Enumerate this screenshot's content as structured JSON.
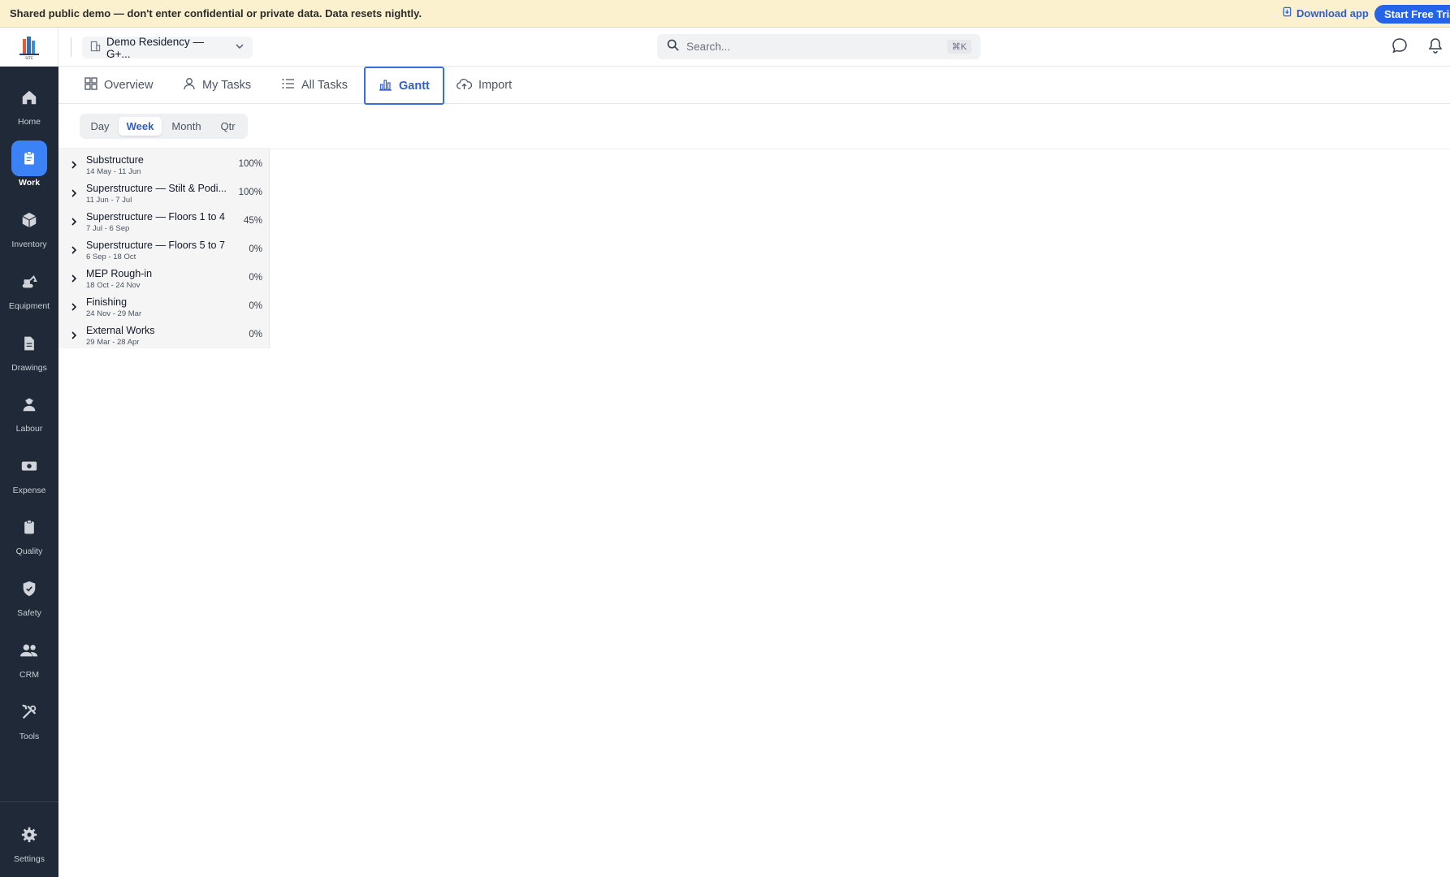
{
  "banner": {
    "text": "Shared public demo — don't enter confidential or private data. Data resets nightly.",
    "download_label": "Download app",
    "trial_label": "Start Free Trial"
  },
  "sidebar": {
    "items": [
      {
        "label": "Home",
        "icon": "home-icon"
      },
      {
        "label": "Work",
        "icon": "clipboard-icon",
        "active": true
      },
      {
        "label": "Inventory",
        "icon": "box-icon"
      },
      {
        "label": "Equipment",
        "icon": "excavator-icon"
      },
      {
        "label": "Drawings",
        "icon": "document-icon"
      },
      {
        "label": "Labour",
        "icon": "worker-icon"
      },
      {
        "label": "Expense",
        "icon": "money-icon"
      },
      {
        "label": "Quality",
        "icon": "clipboard-check-icon"
      },
      {
        "label": "Safety",
        "icon": "shield-icon"
      },
      {
        "label": "CRM",
        "icon": "users-icon"
      },
      {
        "label": "Tools",
        "icon": "tools-icon"
      }
    ],
    "settings_label": "Settings"
  },
  "header": {
    "project_name": "Demo Residency — G+...",
    "search_placeholder": "Search...",
    "search_shortcut": "⌘K"
  },
  "tabs": [
    {
      "label": "Overview",
      "icon": "grid-icon"
    },
    {
      "label": "My Tasks",
      "icon": "user-icon"
    },
    {
      "label": "All Tasks",
      "icon": "list-icon"
    },
    {
      "label": "Gantt",
      "icon": "bar-chart-icon",
      "active": true
    },
    {
      "label": "Import",
      "icon": "cloud-upload-icon"
    }
  ],
  "gantt": {
    "scales": [
      "Day",
      "Week",
      "Month",
      "Qtr"
    ],
    "active_scale": "Week",
    "rows": [
      {
        "name": "Substructure",
        "dates": "14 May - 11 Jun",
        "progress": "100%"
      },
      {
        "name": "Superstructure — Stilt & Podi...",
        "dates": "11 Jun - 7 Jul",
        "progress": "100%"
      },
      {
        "name": "Superstructure — Floors 1 to 4",
        "dates": "7 Jul - 6 Sep",
        "progress": "45%"
      },
      {
        "name": "Superstructure — Floors 5 to 7",
        "dates": "6 Sep - 18 Oct",
        "progress": "0%"
      },
      {
        "name": "MEP Rough-in",
        "dates": "18 Oct - 24 Nov",
        "progress": "0%"
      },
      {
        "name": "Finishing",
        "dates": "24 Nov - 29 Mar",
        "progress": "0%"
      },
      {
        "name": "External Works",
        "dates": "29 Mar - 28 Apr",
        "progress": "0%"
      }
    ]
  },
  "colors": {
    "accent": "#2f5fc7",
    "sidebar_bg": "#1f2937",
    "banner_bg": "#fbf1cf",
    "active_nav": "#3b82f6"
  }
}
